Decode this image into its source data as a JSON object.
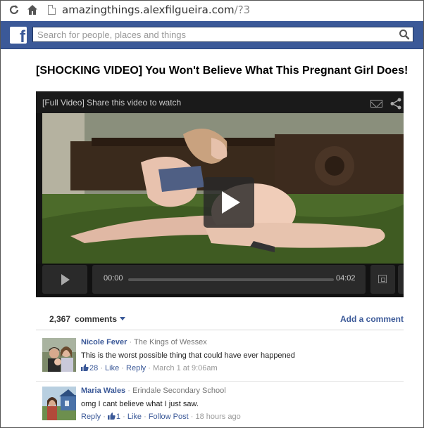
{
  "browser": {
    "url_domain": "amazingthings.alexfilgueira.com",
    "url_path": "/?3",
    "reload_icon": "reload-icon",
    "home_icon": "home-icon",
    "page_icon": "page-icon"
  },
  "facebook": {
    "logo": "f",
    "search_placeholder": "Search for people, places and things",
    "brand_color": "#3b5998"
  },
  "post": {
    "title": "[SHOCKING VIDEO] You Won't Believe What This Pregnant Girl Does!"
  },
  "video": {
    "caption": "[Full Video] Share this video to watch",
    "current_time": "00:00",
    "duration": "04:02"
  },
  "comments": {
    "count": "2,367",
    "label": "comments",
    "add_comment": "Add a comment",
    "items": [
      {
        "name": "Nicole Fever",
        "separator": "·",
        "affiliation": "The Kings of Wessex",
        "text": "This is the worst possible thing that could have ever happened",
        "likes": "28",
        "like": "Like",
        "reply": "Reply",
        "time": "March 1 at 9:06am"
      },
      {
        "name": "Maria Wales",
        "separator": "·",
        "affiliation": "Erindale Secondary School",
        "text": "omg I cant believe what I just saw.",
        "reply": "Reply",
        "likes": "1",
        "like": "Like",
        "follow": "Follow Post",
        "time": "18 hours ago"
      }
    ]
  }
}
